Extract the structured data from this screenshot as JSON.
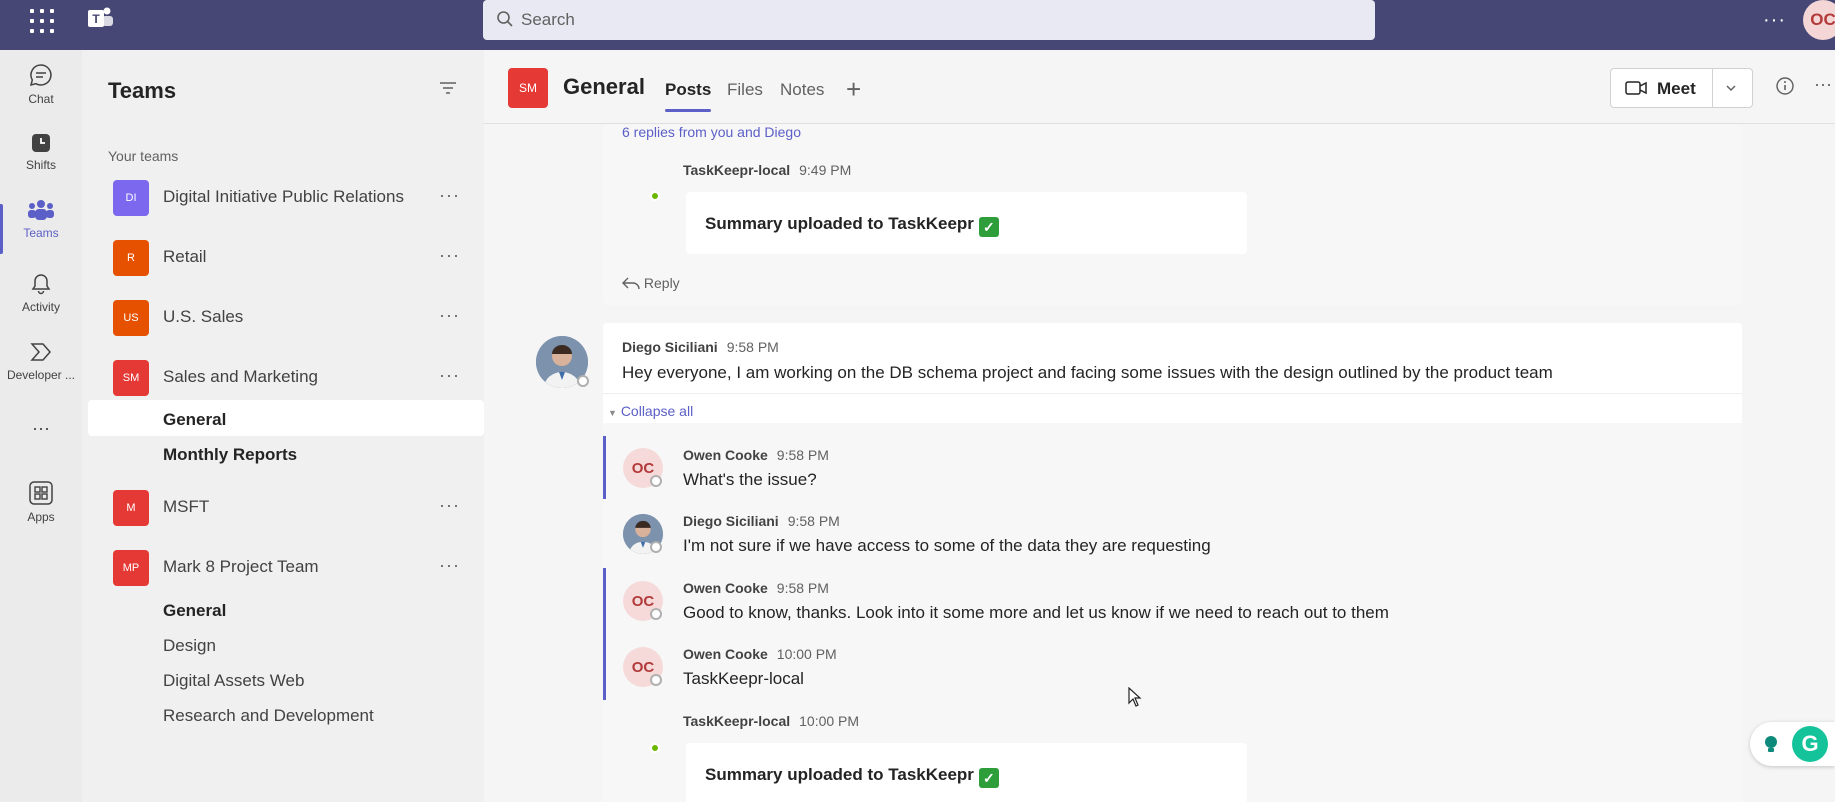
{
  "topbar": {
    "search_placeholder": "Search",
    "more_label": "···",
    "me_initials": "OC"
  },
  "rail": {
    "items": [
      {
        "label": "Chat",
        "icon": "chat-icon"
      },
      {
        "label": "Shifts",
        "icon": "shifts-icon"
      },
      {
        "label": "Teams",
        "icon": "teams-icon",
        "active": true
      },
      {
        "label": "Activity",
        "icon": "bell-icon"
      },
      {
        "label": "Developer ...",
        "icon": "developer-icon"
      },
      {
        "label": "···",
        "icon": "more-icon"
      },
      {
        "label": "Apps",
        "icon": "apps-icon"
      }
    ]
  },
  "left": {
    "title": "Teams",
    "your_teams": "Your teams",
    "teams": [
      {
        "initials": "DI",
        "name": "Digital Initiative Public Relations",
        "color": "#7b68ee"
      },
      {
        "initials": "R",
        "name": "Retail",
        "color": "#e65100"
      },
      {
        "initials": "US",
        "name": "U.S. Sales",
        "color": "#e65100"
      },
      {
        "initials": "SM",
        "name": "Sales and Marketing",
        "color": "#e53935"
      },
      {
        "initials": "M",
        "name": "MSFT",
        "color": "#e53935"
      },
      {
        "initials": "MP",
        "name": "Mark 8 Project Team",
        "color": "#e53935"
      }
    ],
    "sm_channels": [
      "General",
      "Monthly Reports"
    ],
    "mp_channels": [
      "General",
      "Design",
      "Digital Assets Web",
      "Research and Development"
    ],
    "more": "···"
  },
  "header": {
    "avatar": "SM",
    "title": "General",
    "tabs": [
      "Posts",
      "Files",
      "Notes"
    ],
    "add": "+",
    "meet": "Meet",
    "more": "···"
  },
  "feed": {
    "top_replies": "6 replies from you and Diego",
    "bot1": {
      "name": "TaskKeepr-local",
      "time": "9:49 PM",
      "summary": "Summary uploaded to TaskKeepr"
    },
    "reply": "Reply",
    "post": {
      "name": "Diego Siciliani",
      "time": "9:58 PM",
      "text": "Hey everyone, I am working on the DB schema project and facing some issues with the design outlined by the product team"
    },
    "collapse": "Collapse all",
    "replies": [
      {
        "initials": "OC",
        "name": "Owen Cooke",
        "time": "9:58 PM",
        "text": "What's the issue?"
      },
      {
        "name": "Diego Siciliani",
        "time": "9:58 PM",
        "text": "I'm not sure if we have access to some of the data they are requesting"
      },
      {
        "initials": "OC",
        "name": "Owen Cooke",
        "time": "9:58 PM",
        "text": "Good to know, thanks. Look into it some more and let us know if we need to reach out to them"
      },
      {
        "initials": "OC",
        "name": "Owen Cooke",
        "time": "10:00 PM",
        "text": "TaskKeepr-local"
      }
    ],
    "bot2": {
      "name": "TaskKeepr-local",
      "time": "10:00 PM",
      "summary": "Summary uploaded to TaskKeepr"
    },
    "check": "✓"
  },
  "grammarly": {
    "letter": "G"
  },
  "colors": {
    "accent": "#5b5fc7",
    "topbar": "#464775"
  }
}
